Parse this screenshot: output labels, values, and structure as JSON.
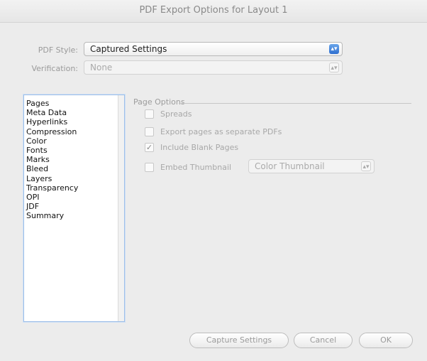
{
  "window": {
    "title": "PDF Export Options for Layout 1"
  },
  "pdf_style": {
    "label": "PDF Style:",
    "value": "Captured Settings"
  },
  "verification": {
    "label": "Verification:",
    "value": "None"
  },
  "categories": [
    "Pages",
    "Meta Data",
    "Hyperlinks",
    "Compression",
    "Color",
    "Fonts",
    "Marks",
    "Bleed",
    "Layers",
    "Transparency",
    "OPI",
    "JDF",
    "Summary"
  ],
  "page_options": {
    "title": "Page Options",
    "spreads": {
      "label": "Spreads",
      "checked": false
    },
    "separate": {
      "label": "Export pages as separate PDFs",
      "checked": false
    },
    "blank": {
      "label": "Include Blank Pages",
      "checked": true
    },
    "thumbnail": {
      "label": "Embed Thumbnail",
      "checked": false,
      "value": "Color Thumbnail"
    }
  },
  "buttons": {
    "capture": "Capture Settings",
    "cancel": "Cancel",
    "ok": "OK"
  },
  "colors": {
    "accent": "#2f6fd0",
    "disabled_text": "#a8a8a8"
  }
}
